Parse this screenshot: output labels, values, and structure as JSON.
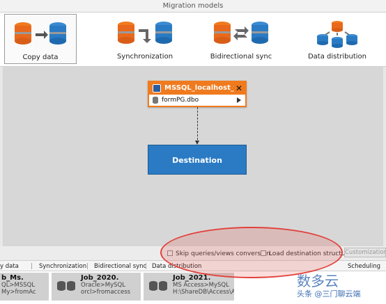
{
  "window": {
    "title": "Migration models"
  },
  "models": [
    {
      "label": "Copy data"
    },
    {
      "label": "Synchronization"
    },
    {
      "label": "Bidirectional sync"
    },
    {
      "label": "Data distribution"
    }
  ],
  "source": {
    "title": "MSSQL_localhost_",
    "table": "formPG.dbo"
  },
  "destination": {
    "label": "Destination"
  },
  "options": {
    "skip_queries": "Skip queries/views conversion",
    "load_structure": "Load destination structure",
    "customization": "Customization"
  },
  "tabs": {
    "copy": "y data",
    "sync": "Synchronization",
    "bidir": "Bidirectional sync",
    "distr": "Data distribution",
    "scheduling": "Scheduling"
  },
  "jobs": [
    {
      "name": "b_Ms.",
      "line1": "QL>MSSQL",
      "line2": "My>fromAc"
    },
    {
      "name": "Job_2020.",
      "line1": "Oracle>MySQL",
      "line2": "orcl>fromaccess"
    },
    {
      "name": "Job_2021.",
      "line1": "MS Access>MySQL",
      "line2": "H:\\ShareDB\\Access\\Al."
    }
  ],
  "watermark": {
    "text": "数多云",
    "sub": "头条 @三门聊云端"
  },
  "colors": {
    "orange": "#f07a1e",
    "blue": "#2b7bc4",
    "annotation": "#e2403a"
  }
}
